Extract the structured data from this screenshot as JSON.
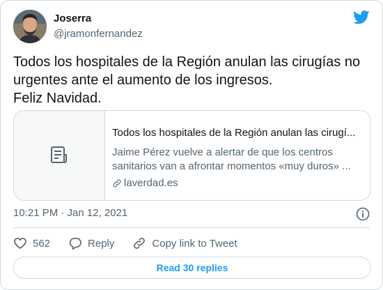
{
  "user": {
    "display_name": "Joserra",
    "handle": "@jramonfernandez"
  },
  "tweet": {
    "lines": [
      "Todos los hospitales de la Región anulan las cirugías no",
      "urgentes ante el aumento de los ingresos.",
      "Feliz Navidad."
    ]
  },
  "card": {
    "title": "Todos los hospitales de la Región anulan las cirugí...",
    "description_lines": [
      "Jaime Pérez vuelve a alertar de que los centros",
      "sanitarios van a afrontar momentos «muy duros» ..."
    ],
    "domain": "laverdad.es",
    "thumbnail_icon": "document-icon"
  },
  "meta": {
    "timestamp": "10:21 PM · Jan 12, 2021"
  },
  "actions": {
    "likes_count": "562",
    "reply_label": "Reply",
    "copy_link_label": "Copy link to Tweet"
  },
  "read_replies_label": "Read 30 replies",
  "colors": {
    "accent": "#1d9bf0",
    "text": "#0f1419",
    "muted": "#536471",
    "border": "#cfd9de"
  }
}
